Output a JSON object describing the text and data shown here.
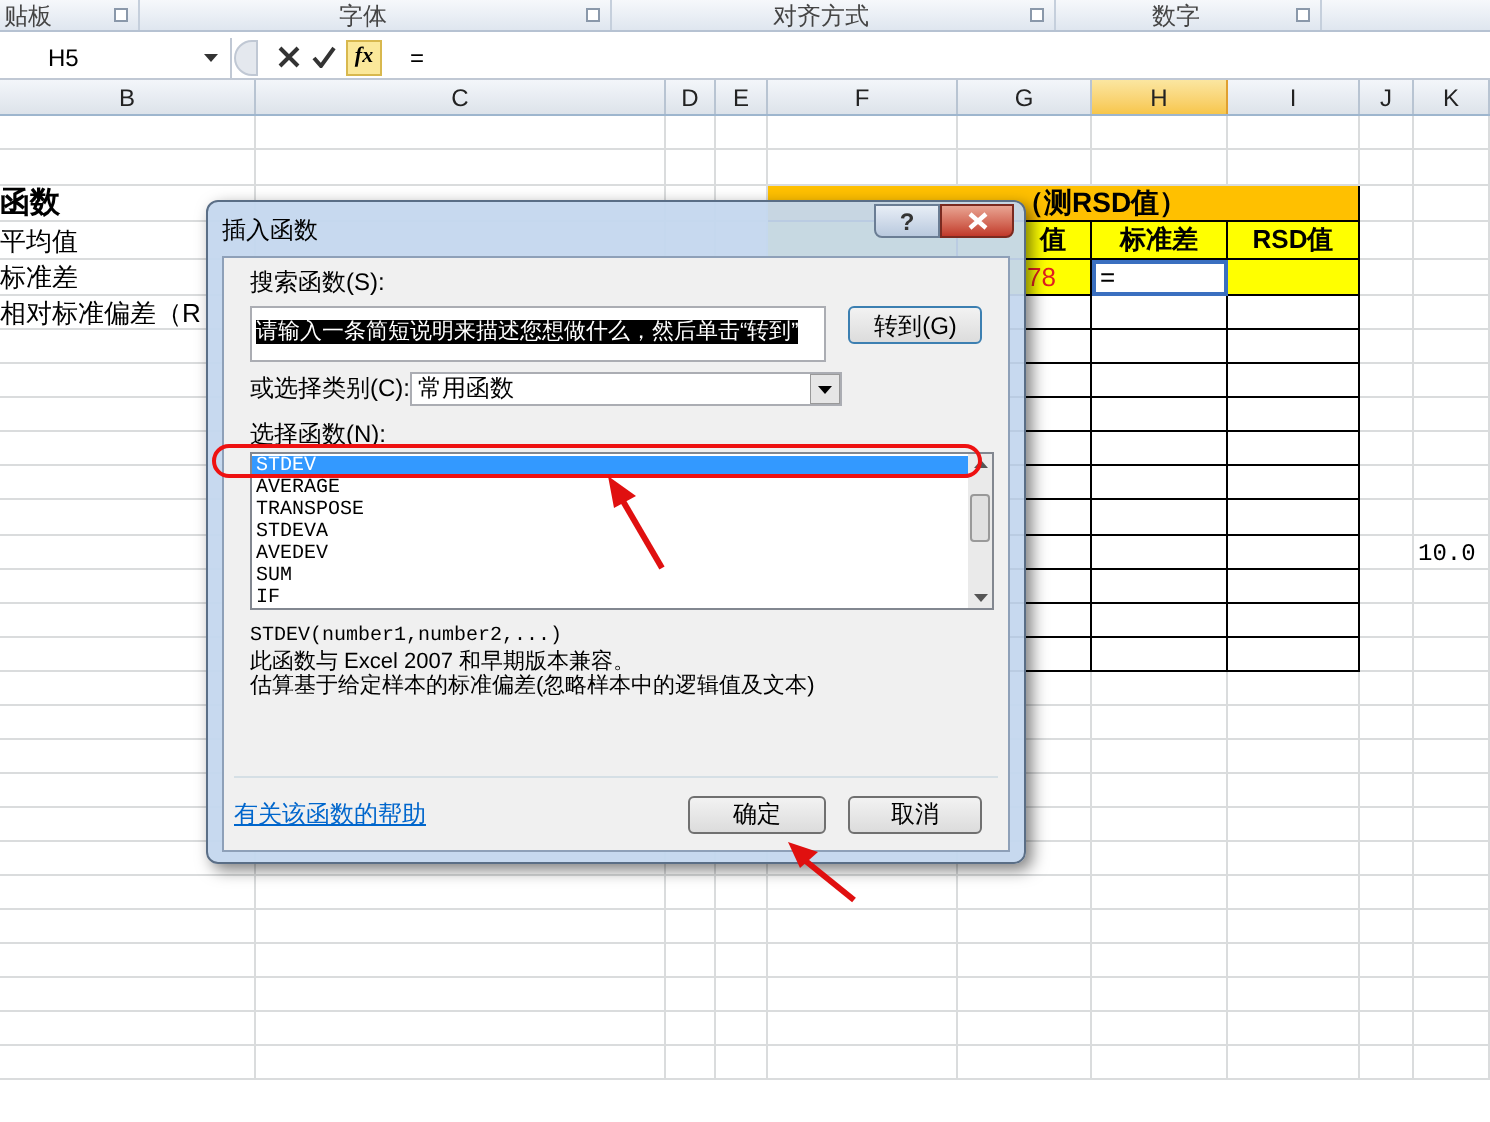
{
  "ribbon_groups": [
    {
      "label": "贴板"
    },
    {
      "label": "字体"
    },
    {
      "label": "对齐方式"
    },
    {
      "label": "数字"
    }
  ],
  "formula_bar": {
    "name_box": "H5",
    "function_button": "fx",
    "formula": "="
  },
  "columns": [
    {
      "label": "B",
      "selected": false
    },
    {
      "label": "C",
      "selected": false
    },
    {
      "label": "D",
      "selected": false
    },
    {
      "label": "E",
      "selected": false
    },
    {
      "label": "F",
      "selected": false
    },
    {
      "label": "G",
      "selected": false
    },
    {
      "label": "H",
      "selected": true
    },
    {
      "label": "I",
      "selected": false
    },
    {
      "label": "J",
      "selected": false
    },
    {
      "label": "K",
      "selected": false
    }
  ],
  "left_list": {
    "headings": [
      "函数"
    ],
    "items": [
      "平均值",
      "标准差",
      "相对标准偏差（R"
    ]
  },
  "example_table": {
    "title": "（测RSD值）",
    "headers": [
      "值",
      "标准差",
      "RSD值"
    ],
    "first_row": [
      {
        "text": "78",
        "selected": false
      },
      {
        "text": "=",
        "selected": true
      }
    ]
  },
  "side_value": "10.0",
  "dialog": {
    "title": "插入函数",
    "help_button": "?",
    "search_label": "搜索函数(S):",
    "search_value": "请输入一条简短说明来描述您想做什么，然后单击“转到”",
    "go_button": "转到(G)",
    "category_label": "或选择类别(C):",
    "category_value": "常用函数",
    "list_label": "选择函数(N):",
    "functions": [
      {
        "label": "STDEV",
        "selected": true
      },
      {
        "label": "AVERAGE",
        "selected": false
      },
      {
        "label": "TRANSPOSE",
        "selected": false
      },
      {
        "label": "STDEVA",
        "selected": false
      },
      {
        "label": "AVEDEV",
        "selected": false
      },
      {
        "label": "SUM",
        "selected": false
      },
      {
        "label": "IF",
        "selected": false
      }
    ],
    "signature": "STDEV(number1,number2,...)",
    "description": [
      "此函数与 Excel 2007 和早期版本兼容。",
      "估算基于给定样本的标准偏差(忽略样本中的逻辑值及文本)"
    ],
    "help_link": "有关该函数的帮助",
    "ok_button": "确定",
    "cancel_button": "取消"
  }
}
